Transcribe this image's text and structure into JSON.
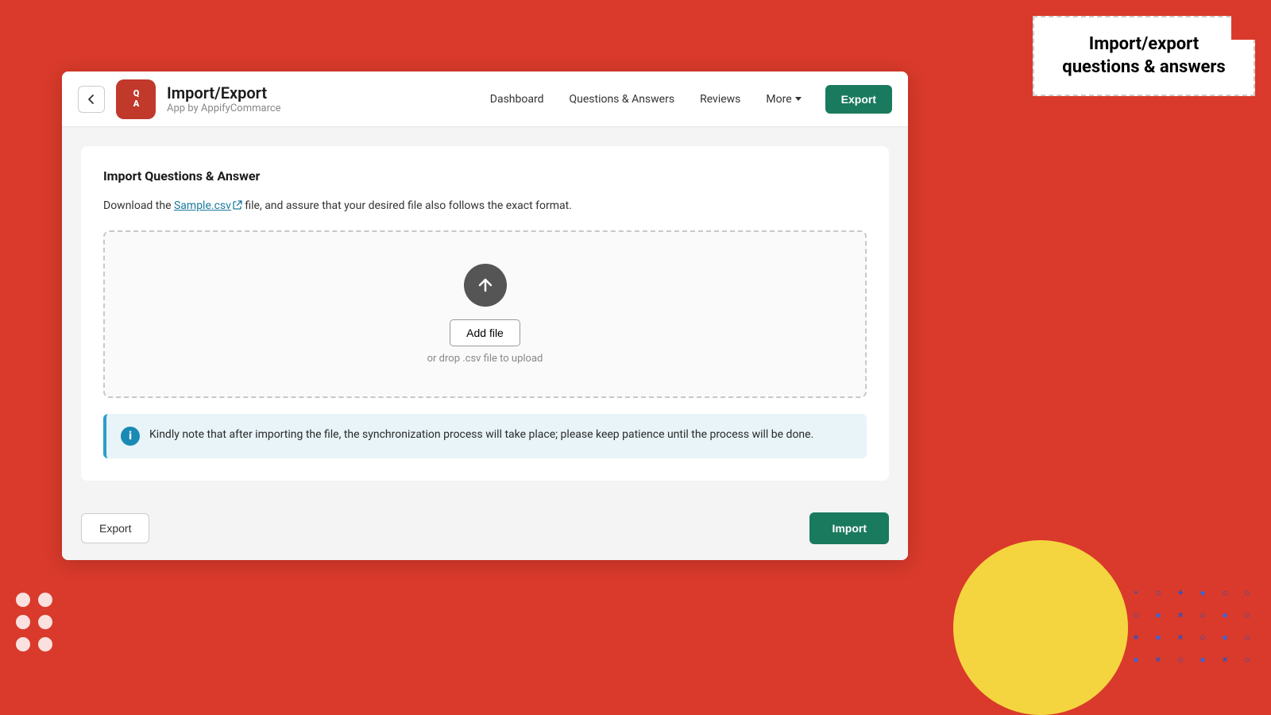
{
  "background": {
    "color": "#d93a2b"
  },
  "tooltip": {
    "text": "Import/export questions & answers"
  },
  "header": {
    "back_label": "←",
    "logo_text": "Q\nA",
    "app_title": "Import/Export",
    "app_subtitle": "App by AppifyCommarce",
    "nav": [
      {
        "label": "Dashboard"
      },
      {
        "label": "Questions & Answers"
      },
      {
        "label": "Reviews"
      },
      {
        "label": "More"
      }
    ],
    "export_button": "Export"
  },
  "content": {
    "section_title": "Import Questions & Answer",
    "sample_text_before": "Download the ",
    "sample_link": "Sample.csv",
    "sample_text_after": " file, and assure that your desired file also follows the exact format.",
    "upload": {
      "add_file_label": "Add file",
      "drop_hint": "or drop .csv file to upload"
    },
    "info_message": "Kindly note that after importing the file, the synchronization process will take place; please keep patience until the process will be done."
  },
  "footer": {
    "export_label": "Export",
    "import_label": "Import"
  }
}
